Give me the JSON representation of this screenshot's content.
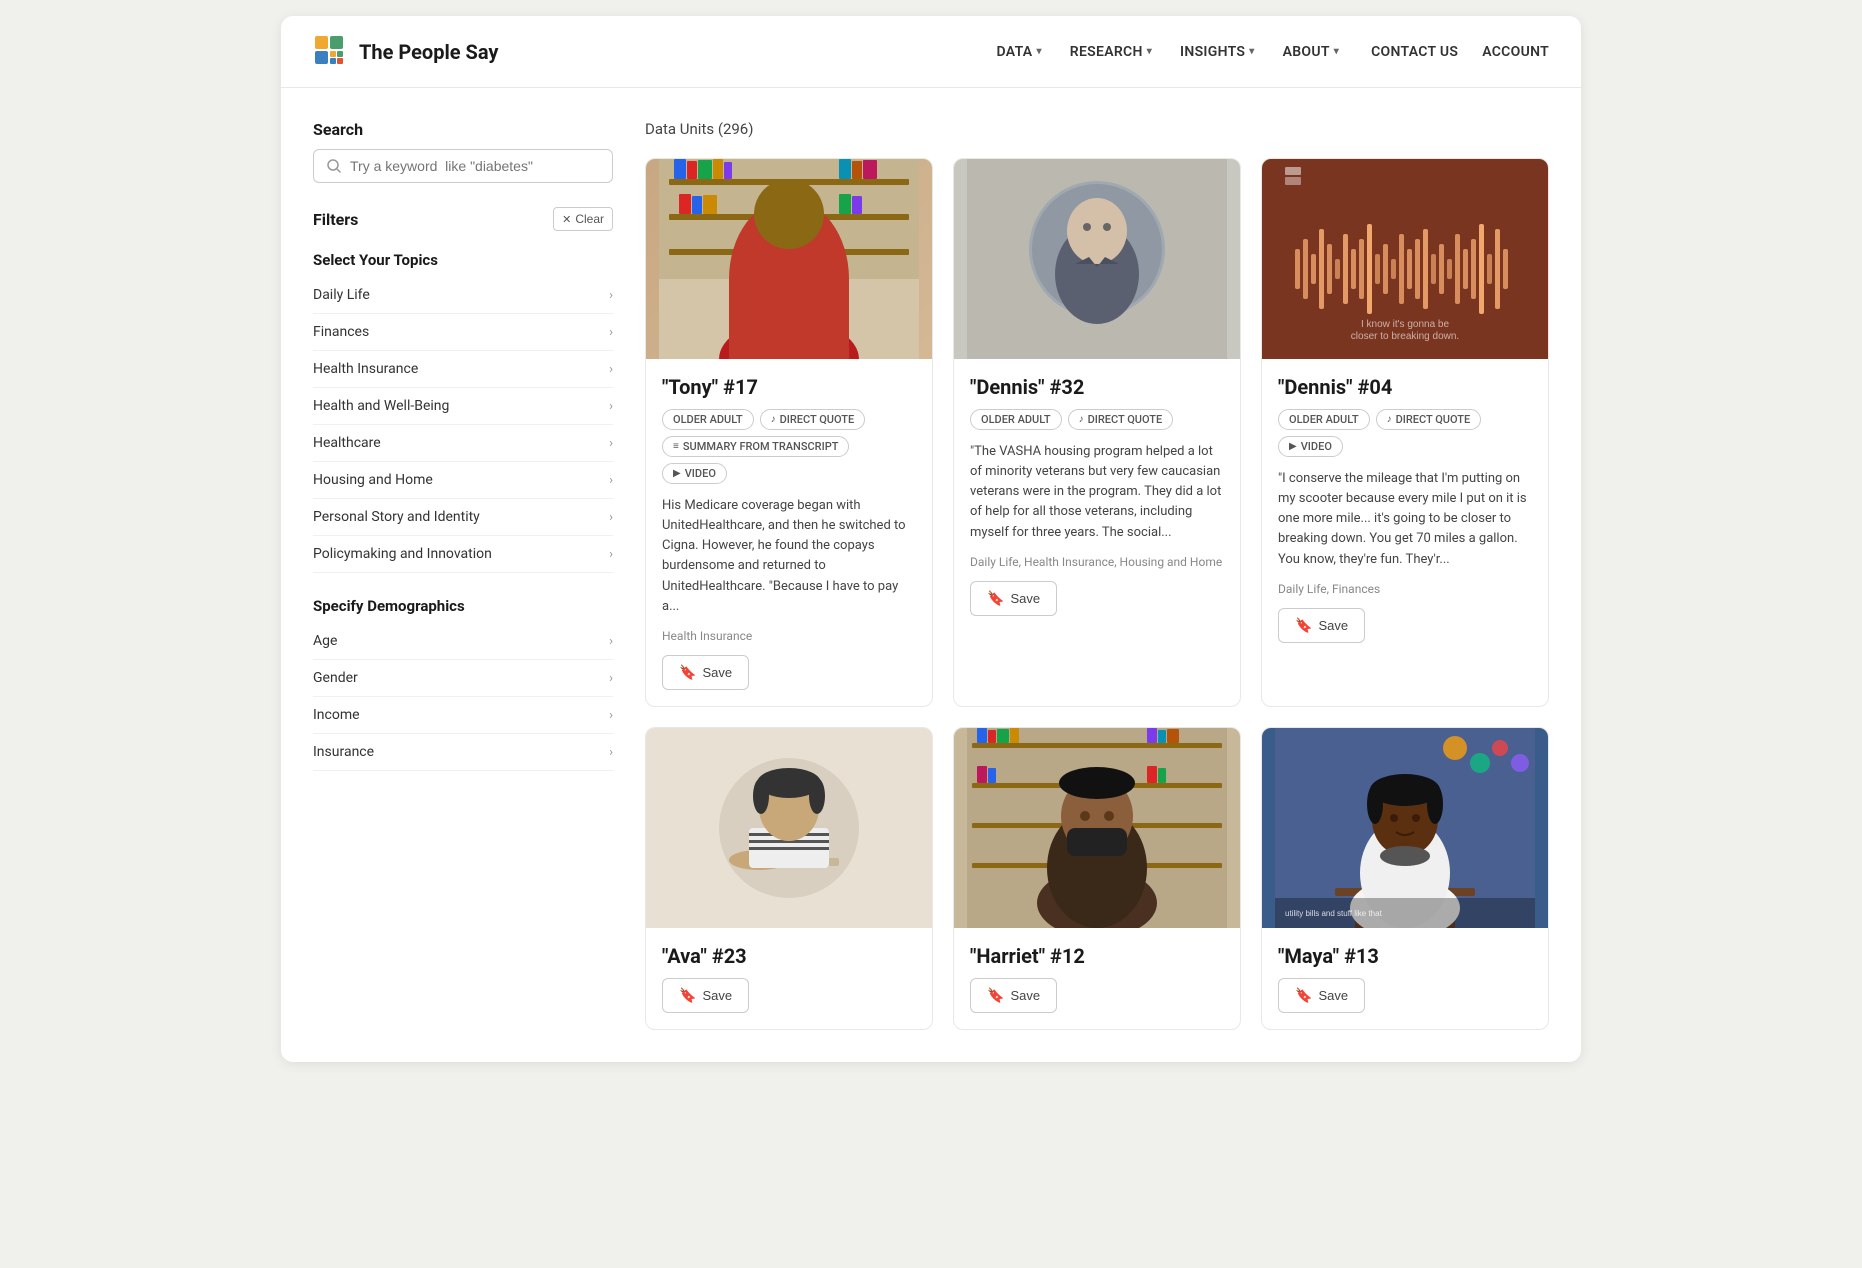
{
  "app": {
    "title": "The People Say"
  },
  "header": {
    "logo_text": "The People Say",
    "nav_items": [
      {
        "label": "DATA",
        "has_dropdown": true
      },
      {
        "label": "RESEARCH",
        "has_dropdown": true
      },
      {
        "label": "INSIGHTS",
        "has_dropdown": true
      },
      {
        "label": "ABOUT",
        "has_dropdown": true
      }
    ],
    "contact_label": "CONTACT US",
    "account_label": "ACCOUNT"
  },
  "sidebar": {
    "search_label": "Search",
    "search_placeholder": "Try a keyword  like \"diabetes\"",
    "filters_label": "Filters",
    "clear_label": "Clear",
    "topics_label": "Select Your Topics",
    "topics": [
      {
        "label": "Daily Life"
      },
      {
        "label": "Finances"
      },
      {
        "label": "Health Insurance"
      },
      {
        "label": "Health and Well-Being"
      },
      {
        "label": "Healthcare"
      },
      {
        "label": "Housing and Home"
      },
      {
        "label": "Personal Story and Identity"
      },
      {
        "label": "Policymaking and Innovation"
      }
    ],
    "demographics_label": "Specify Demographics",
    "demographics": [
      {
        "label": "Age"
      },
      {
        "label": "Gender"
      },
      {
        "label": "Income"
      },
      {
        "label": "Insurance"
      }
    ]
  },
  "main": {
    "results_label": "Data Units (296)",
    "cards": [
      {
        "id": "tony-17",
        "title": "\"Tony\" #17",
        "tags": [
          "OLDER ADULT",
          "DIRECT QUOTE",
          "SUMMARY FROM TRANSCRIPT",
          "VIDEO"
        ],
        "text": "His Medicare coverage began with UnitedHealthcare, and then he switched to Cigna. However, he found the copays burdensome and returned to UnitedHealthcare. \"Because I have to pay a...",
        "category": "Health Insurance",
        "save_label": "Save",
        "image_type": "tony"
      },
      {
        "id": "dennis-32",
        "title": "\"Dennis\" #32",
        "tags": [
          "OLDER ADULT",
          "DIRECT QUOTE"
        ],
        "text": "\"The VASHA housing program helped a lot of minority veterans but very few caucasian veterans were in the program. They did a lot of help for all those veterans, including myself for three years. The social...",
        "category": "Daily Life, Health Insurance, Housing and Home",
        "save_label": "Save",
        "image_type": "dennis32"
      },
      {
        "id": "dennis-04",
        "title": "\"Dennis\" #04",
        "tags": [
          "OLDER ADULT",
          "DIRECT QUOTE",
          "VIDEO"
        ],
        "text": "\"I conserve the mileage that I'm putting on my scooter because every mile I put on it is one more mile... it's going to be closer to breaking down. You get 70 miles a gallon. You know, they're fun. They'r...",
        "category": "Daily Life, Finances",
        "save_label": "Save",
        "image_type": "dennis04"
      },
      {
        "id": "ava-23",
        "title": "\"Ava\" #23",
        "tags": [],
        "text": "",
        "category": "",
        "save_label": "Save",
        "image_type": "ava"
      },
      {
        "id": "harriet-12",
        "title": "\"Harriet\" #12",
        "tags": [],
        "text": "",
        "category": "",
        "save_label": "Save",
        "image_type": "harriet"
      },
      {
        "id": "maya-13",
        "title": "\"Maya\" #13",
        "tags": [],
        "text": "",
        "category": "",
        "save_label": "Save",
        "image_type": "maya"
      }
    ]
  }
}
